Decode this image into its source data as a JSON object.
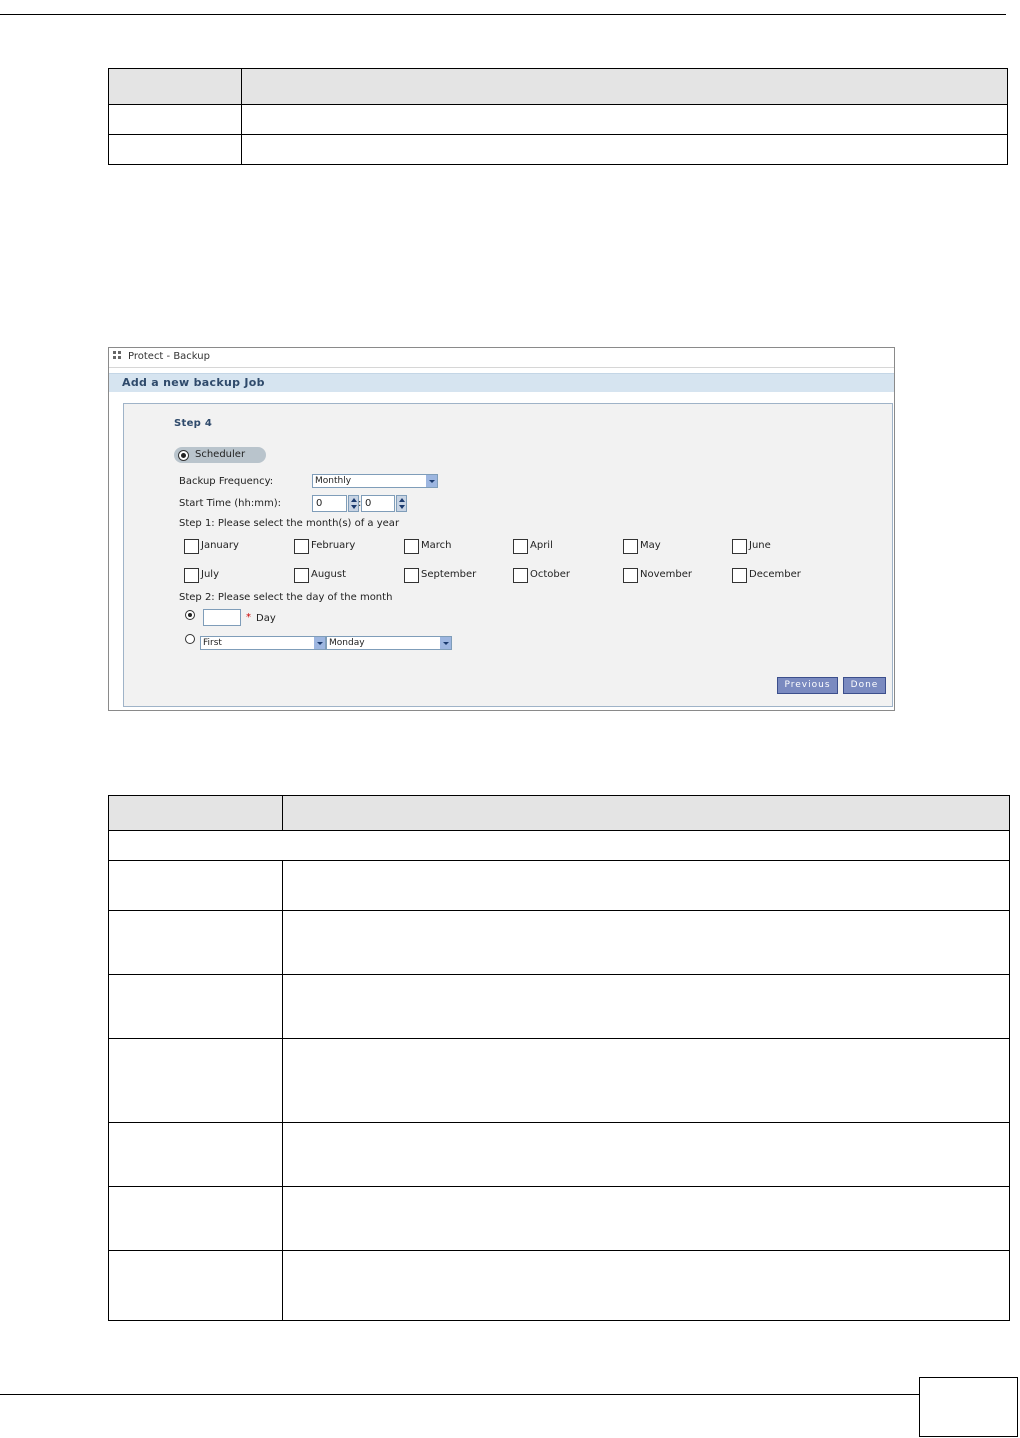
{
  "screenshot": {
    "window_title": "Protect - Backup",
    "header": "Add a new backup Job",
    "step_heading": "Step 4",
    "scheduler_label": "Scheduler",
    "backup_frequency": {
      "label": "Backup Frequency:",
      "value": "Monthly"
    },
    "start_time": {
      "label": "Start Time (hh:mm):",
      "hours": "0",
      "separator": ":",
      "minutes": "0"
    },
    "months_prompt": "Step 1: Please select the month(s) of a year",
    "months": [
      "January",
      "February",
      "March",
      "April",
      "May",
      "June",
      "July",
      "August",
      "September",
      "October",
      "November",
      "December"
    ],
    "day_prompt": "Step 2: Please select the day of the month",
    "day_option": {
      "required_mark": "*",
      "label": "Day",
      "value": ""
    },
    "weekday_option": {
      "ordinal": "First",
      "weekday": "Monday"
    },
    "buttons": {
      "previous": "Previous",
      "done": "Done"
    }
  }
}
